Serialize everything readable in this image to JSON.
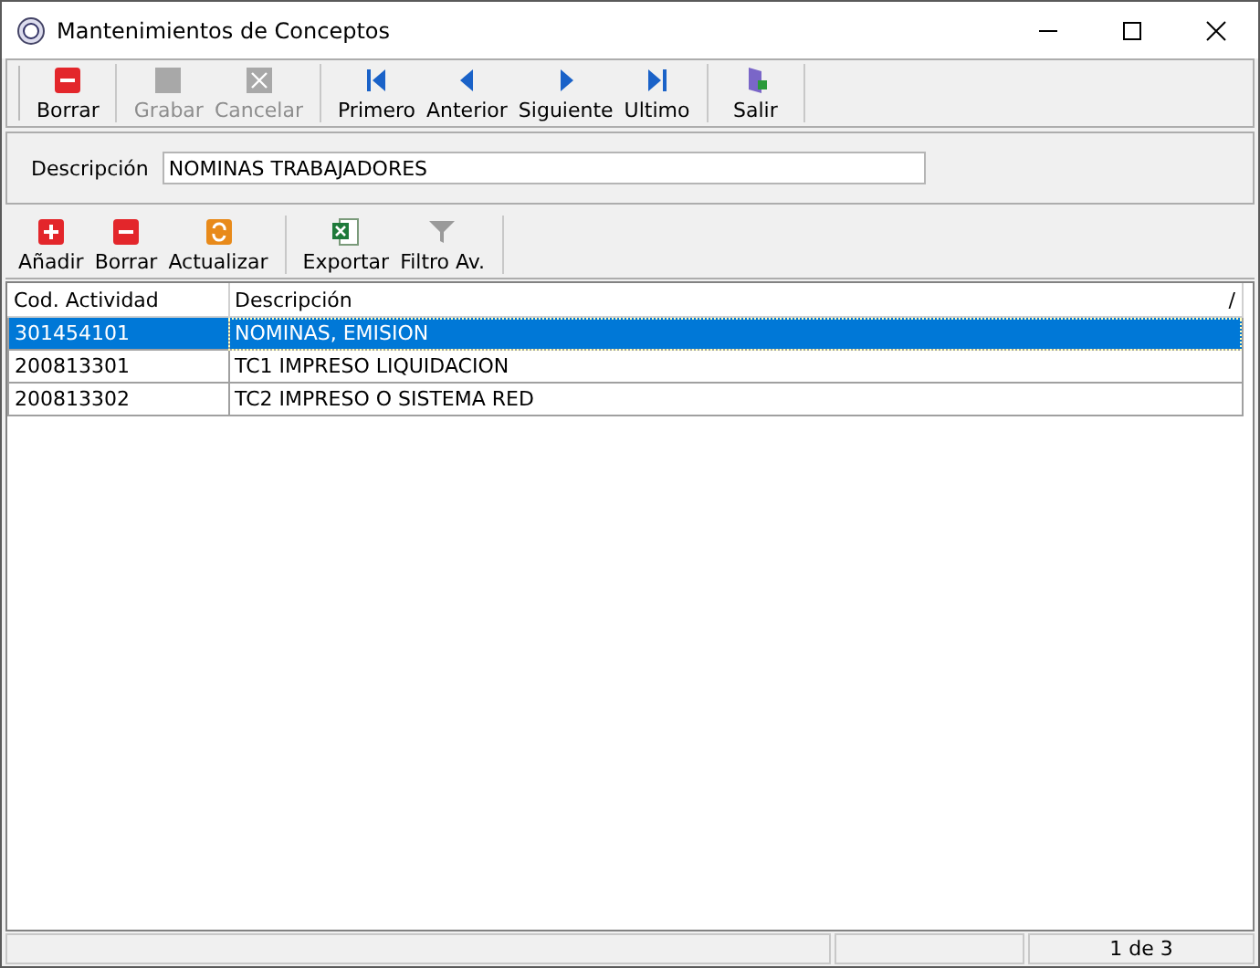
{
  "window": {
    "title": "Mantenimientos de Conceptos"
  },
  "toolbar": [
    {
      "kind": "delete",
      "label": "Borrar",
      "disabled": false,
      "separator_before": false
    },
    {
      "kind": "save",
      "label": "Grabar",
      "disabled": true,
      "separator_before": true
    },
    {
      "kind": "cancel",
      "label": "Cancelar",
      "disabled": true,
      "separator_before": false
    },
    {
      "kind": "first",
      "label": "Primero",
      "disabled": false,
      "separator_before": true
    },
    {
      "kind": "prev",
      "label": "Anterior",
      "disabled": false,
      "separator_before": false
    },
    {
      "kind": "next",
      "label": "Siguiente",
      "disabled": false,
      "separator_before": false
    },
    {
      "kind": "last",
      "label": "Ultimo",
      "disabled": false,
      "separator_before": false
    },
    {
      "kind": "exit",
      "label": "Salir",
      "disabled": false,
      "separator_before": true
    }
  ],
  "filter": {
    "label": "Descripción",
    "value": "NOMINAS TRABAJADORES"
  },
  "grid_toolbar": [
    {
      "kind": "add",
      "label": "Añadir",
      "separator_before": false
    },
    {
      "kind": "delete",
      "label": "Borrar",
      "separator_before": false
    },
    {
      "kind": "refresh",
      "label": "Actualizar",
      "separator_before": false
    },
    {
      "kind": "excel",
      "label": "Exportar",
      "separator_before": true
    },
    {
      "kind": "filter",
      "label": "Filtro Av.",
      "separator_before": false
    }
  ],
  "table": {
    "columns": [
      "Cod. Actividad",
      "Descripción"
    ],
    "sort_mark": "/",
    "rows": [
      {
        "cells": [
          "301454101",
          "NOMINAS, EMISION"
        ],
        "selected": true
      },
      {
        "cells": [
          "200813301",
          "TC1 IMPRESO LIQUIDACION"
        ],
        "selected": false
      },
      {
        "cells": [
          "200813302",
          "TC2 IMPRESO O SISTEMA RED"
        ],
        "selected": false
      }
    ]
  },
  "status_bar": {
    "record_position": "1 de 3"
  }
}
